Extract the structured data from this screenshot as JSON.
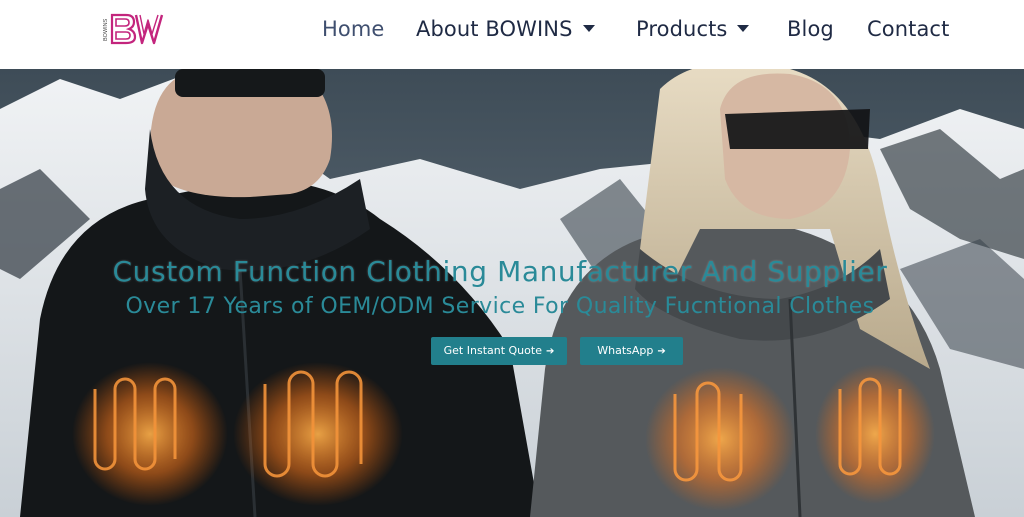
{
  "logo": {
    "mark": "BW",
    "side_text": "BOWINS",
    "color": "#c3257d"
  },
  "nav": {
    "items": [
      {
        "label": "Home",
        "active": true
      },
      {
        "label": "About BOWINS",
        "dropdown": true
      },
      {
        "label": "Products",
        "dropdown": true
      },
      {
        "label": "Blog"
      },
      {
        "label": "Contact"
      }
    ]
  },
  "hero": {
    "headline": "Custom Function Clothing Manufacturer And Supplier",
    "subline": "Over 17 Years of OEM/ODM Service For Quality Fucntional Clothes",
    "text_color": "#2a8a98",
    "buttons": {
      "quote": {
        "label": "Get Instant Quote",
        "icon": "arrow-right-icon"
      },
      "whatsapp": {
        "label": "WhatsApp",
        "icon": "arrow-right-icon"
      }
    },
    "button_color": "#227f8c"
  }
}
